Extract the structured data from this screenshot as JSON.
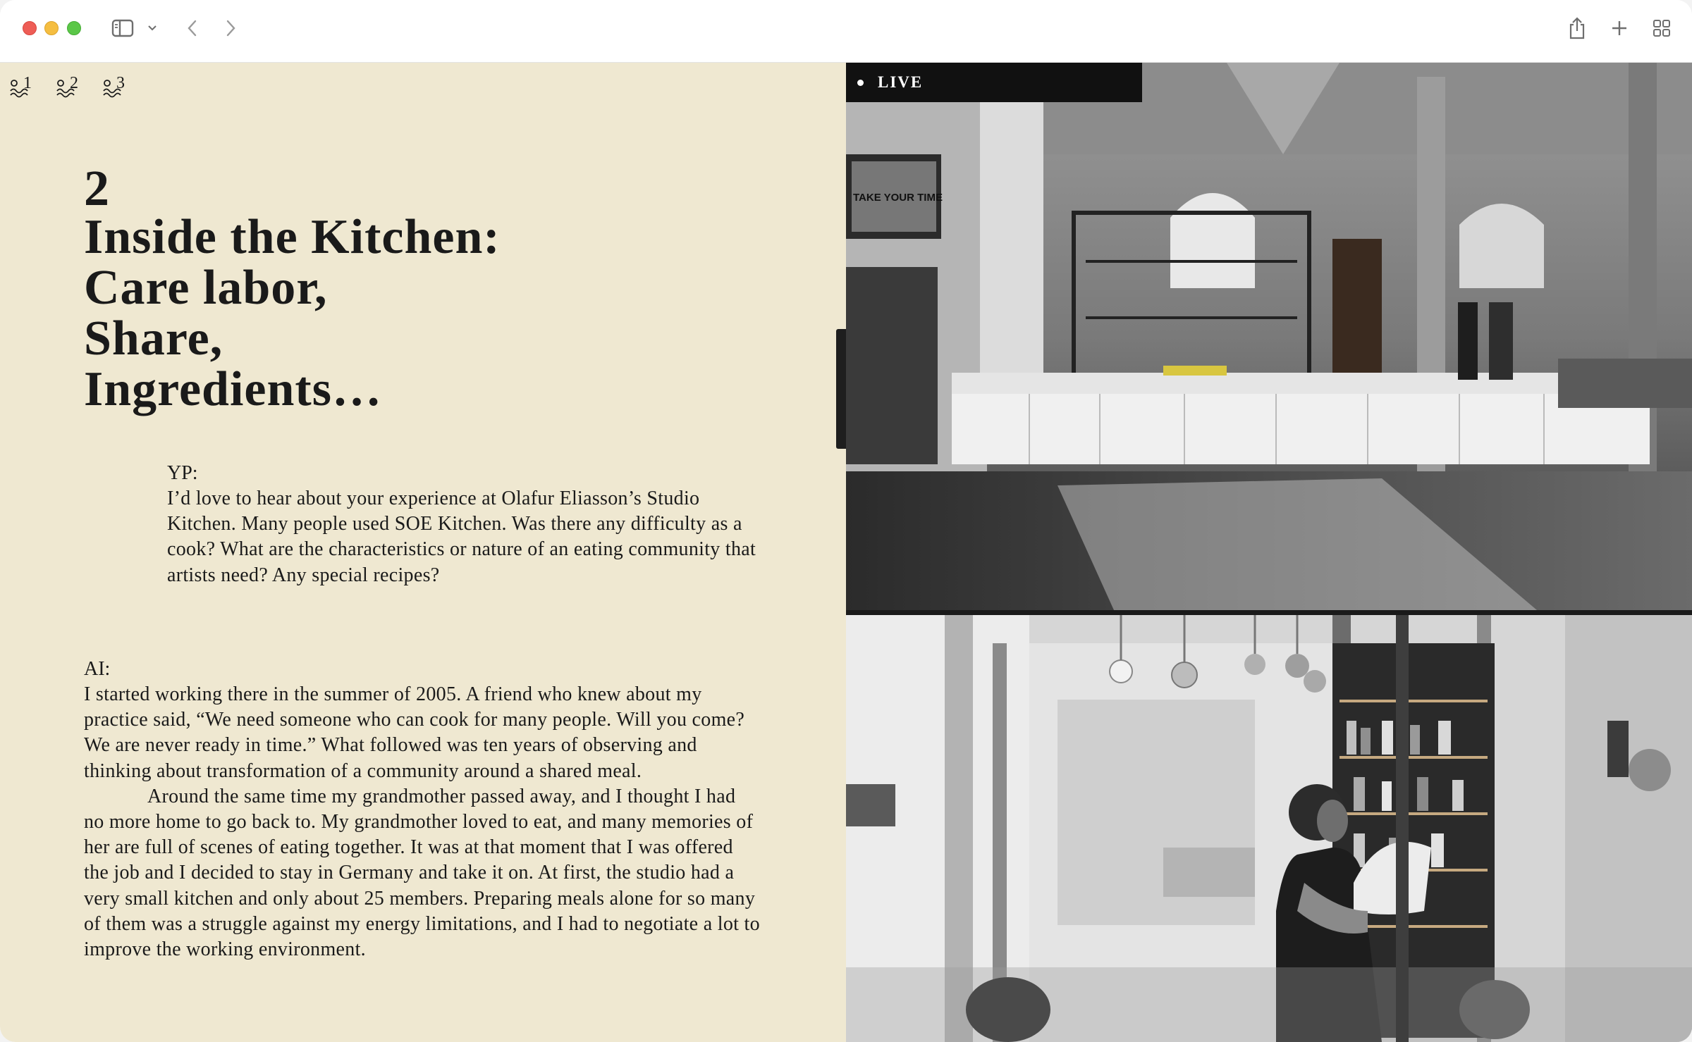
{
  "toolbar": {
    "icons": [
      "sidebar-icon",
      "chevron-down-icon",
      "back-icon",
      "forward-icon",
      "share-icon",
      "new-tab-icon",
      "tab-overview-icon"
    ]
  },
  "pager": {
    "items": [
      {
        "label": "1"
      },
      {
        "label": "2"
      },
      {
        "label": "3"
      }
    ]
  },
  "chapter": {
    "number": "2",
    "title_lines": [
      "Inside the Kitchen:",
      "Care labor,",
      "Share,",
      "Ingredients…"
    ]
  },
  "question": {
    "speaker": "YP:",
    "text": "I’d love to hear about your experience at Olafur Eliasson’s Studio Kitchen. Many people used SOE Kitchen. Was there any difficulty as a cook? What are the characteristics or nature of an eating community that artists need? Any special recipes?"
  },
  "answer": {
    "speaker": "AI:",
    "paragraphs": [
      "I started working there in the summer of 2005. A friend who knew about my practice said, “We need someone who can cook for many people. Will you come? We are never ready in time.” What followed was ten years of observing and thinking about transformation of a community around a shared meal.",
      "Around the same time my grandmother passed away, and I thought I had no more home to go back to. My grandmother loved to eat, and many memories of her are full of scenes of eating together. It was at that moment that I was offered the job and I decided to stay in Germany and take it on. At first, the studio had a very small kitchen and only about 25 members. Preparing meals alone for so many of them was a struggle against my energy limitations, and I had to negotiate a lot to improve the working environment."
    ]
  },
  "live": {
    "label": "LIVE"
  },
  "photos": {
    "top_poster_text": "TAKE YOUR TIME"
  },
  "colors": {
    "page_bg": "#efe8d1",
    "text": "#1a1a1a"
  }
}
